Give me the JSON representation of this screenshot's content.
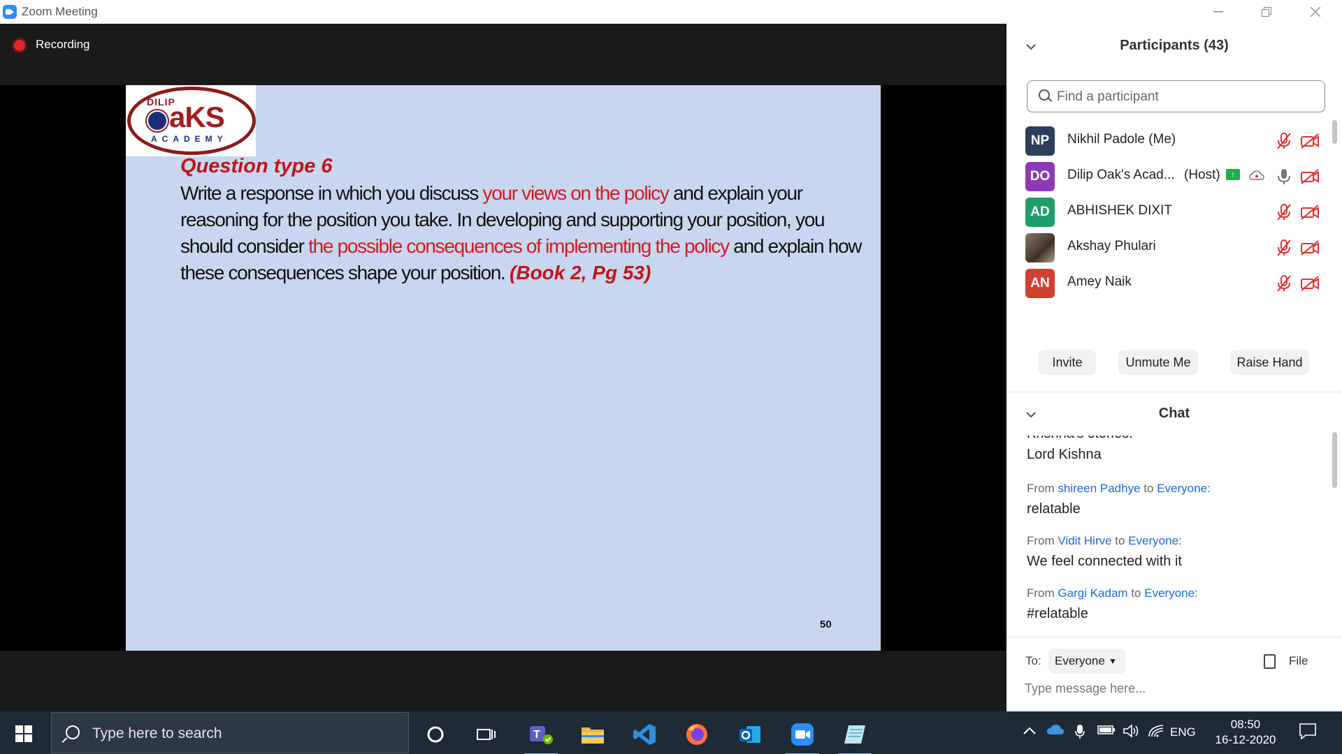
{
  "window": {
    "title": "Zoom Meeting",
    "controls": [
      "minimize",
      "restore",
      "close"
    ]
  },
  "meeting": {
    "recording_label": "Recording",
    "slide": {
      "logo_text": {
        "dilip": "DILIP",
        "oaks": "aKS",
        "academy": "ACADEMY"
      },
      "question_title": "Question type 6",
      "body_segments": [
        {
          "text": "Write a response in which you discuss ",
          "style": "normal"
        },
        {
          "text": "your views on the policy",
          "style": "red"
        },
        {
          "text": " and explain your reasoning for the position you take. In developing and supporting your position, you should consider ",
          "style": "normal"
        },
        {
          "text": "the possible consequences of implementing the policy",
          "style": "red"
        },
        {
          "text": " and explain how these consequences shape your position. ",
          "style": "normal"
        },
        {
          "text": "(Book 2, Pg 53)",
          "style": "ref"
        }
      ],
      "page_number": "50"
    }
  },
  "participants": {
    "header": "Participants (43)",
    "search_placeholder": "Find a participant",
    "list": [
      {
        "initials": "NP",
        "name": "Nikhil Padole (Me)",
        "role": "",
        "avatar_color": "#2e3f5c",
        "mic": "muted",
        "video": "off"
      },
      {
        "initials": "DO",
        "name": "Dilip Oak's Acad...",
        "role": "(Host)",
        "avatar_color": "#8e3ab8",
        "mic": "on",
        "video": "off",
        "sharing": true
      },
      {
        "initials": "AD",
        "name": "ABHISHEK DIXIT",
        "role": "",
        "avatar_color": "#1f9d6b",
        "mic": "muted",
        "video": "off"
      },
      {
        "initials": "",
        "name": "Akshay Phulari",
        "role": "",
        "avatar_color": "#5a4a3a",
        "mic": "muted",
        "video": "off"
      },
      {
        "initials": "AN",
        "name": "Amey Naik",
        "role": "",
        "avatar_color": "#d1402f",
        "mic": "muted",
        "video": "off"
      }
    ],
    "buttons": {
      "invite": "Invite",
      "unmute": "Unmute Me",
      "raise_hand": "Raise Hand"
    }
  },
  "chat": {
    "header": "Chat",
    "partial_text": "Krishna's stories.",
    "first_body": "Lord Kishna",
    "messages": [
      {
        "from_prefix": "From",
        "sender": "shireen Padhye",
        "to_word": "to",
        "recipient": "Everyone:",
        "body": "relatable"
      },
      {
        "from_prefix": "From",
        "sender": "Vidit Hirve",
        "to_word": "to",
        "recipient": "Everyone:",
        "body": "We feel connected with it"
      },
      {
        "from_prefix": "From",
        "sender": "Gargi Kadam",
        "to_word": "to",
        "recipient": "Everyone:",
        "body": "#relatable"
      }
    ],
    "to_label": "To:",
    "to_value": "Everyone",
    "file_label": "File",
    "input_placeholder": "Type message here..."
  },
  "taskbar": {
    "search_placeholder": "Type here to search",
    "apps": [
      "cortana",
      "task-view",
      "teams",
      "file-explorer",
      "vscode",
      "firefox",
      "outlook",
      "zoom",
      "notes"
    ],
    "language": "ENG",
    "time": "08:50",
    "date": "16-12-2020"
  }
}
